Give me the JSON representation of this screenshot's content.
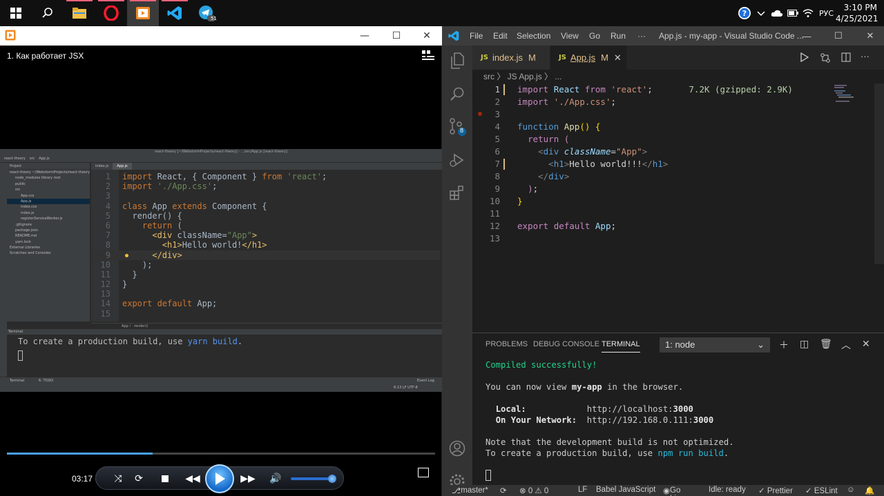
{
  "taskbar": {
    "clock_time": "3:10 PM",
    "clock_date": "4/25/2021",
    "language": "РУС",
    "telegram_badge": "51"
  },
  "player": {
    "video_title": "1. Как работает JSX",
    "elapsed": "03:17",
    "progress": 0.34,
    "volume": 0.9
  },
  "webstorm": {
    "title": "react-theory [~/WebstormProjects/react-theory] - .../src/App.js [react-theory]",
    "nav": [
      "react-theory",
      "src",
      "App.js"
    ],
    "project_header": "Project",
    "tree": [
      {
        "label": "react-theory  ~/WebstormProjects/react-theory",
        "indent": 0
      },
      {
        "label": "node_modules  library root",
        "indent": 1
      },
      {
        "label": "public",
        "indent": 1
      },
      {
        "label": "src",
        "indent": 1
      },
      {
        "label": "App.css",
        "indent": 2
      },
      {
        "label": "App.js",
        "indent": 2,
        "selected": true
      },
      {
        "label": "index.css",
        "indent": 2
      },
      {
        "label": "index.js",
        "indent": 2
      },
      {
        "label": "registerServiceWorker.js",
        "indent": 2
      },
      {
        "label": ".gitignore",
        "indent": 1
      },
      {
        "label": "package.json",
        "indent": 1
      },
      {
        "label": "README.md",
        "indent": 1
      },
      {
        "label": "yarn.lock",
        "indent": 1
      },
      {
        "label": "External Libraries",
        "indent": 0
      },
      {
        "label": "Scratches and Consoles",
        "indent": 0
      }
    ],
    "tabs": [
      "index.js",
      "App.js"
    ],
    "breadcrumb": "App  〉 render()",
    "terminal_header": "Terminal",
    "terminal_line_pre": "To create a production build, use ",
    "terminal_line_cmd": "yarn build",
    "terminal_line_post": ".",
    "bottom_tabs": [
      "Terminal",
      "6: TODO"
    ],
    "event_log": "Event Log",
    "status_right": "6:13  LF  UTF-8"
  },
  "vscode": {
    "menu": [
      "File",
      "Edit",
      "Selection",
      "View",
      "Go",
      "Run",
      "···"
    ],
    "window_title": "App.js - my-app - Visual Studio Code ...",
    "scm_badge": "8",
    "tabs": [
      {
        "label": "index.js",
        "status": "M"
      },
      {
        "label": "App.js",
        "status": "M"
      }
    ],
    "crumbs": "src  〉 JS App.js 〉 ...",
    "import_cost": "7.2K (gzipped: 2.9K)",
    "panel_tabs": [
      "PROBLEMS",
      "DEBUG CONSOLE",
      "TERMINAL"
    ],
    "terminal_select": "1: node",
    "terminal": {
      "compiled": "Compiled successfully!",
      "view_pre": "You can now view ",
      "view_app": "my-app",
      "view_post": " in the browser.",
      "local_label": "Local:",
      "local_url_pre": "http://localhost:",
      "local_port": "3000",
      "network_label": "On Your Network:",
      "network_url_pre": "http://192.168.0.111:",
      "network_port": "3000",
      "note1": "Note that the development build is not optimized.",
      "note2_pre": "To create a production build, use ",
      "note2_cmd": "npm run build",
      "note2_post": "."
    },
    "status": {
      "branch": "master*",
      "errors": "⊗ 0 ⚠ 0",
      "eol": "LF",
      "language": "Babel JavaScript",
      "golive": "Go Live",
      "tsserver": "Idle: ready",
      "prettier": "✓ Prettier",
      "eslint": "✓ ESLint"
    }
  },
  "colors": {
    "vscode_bg": "#1e1e1e",
    "webstorm_bg": "#2b2b2b",
    "accent_blue": "#007acc"
  }
}
